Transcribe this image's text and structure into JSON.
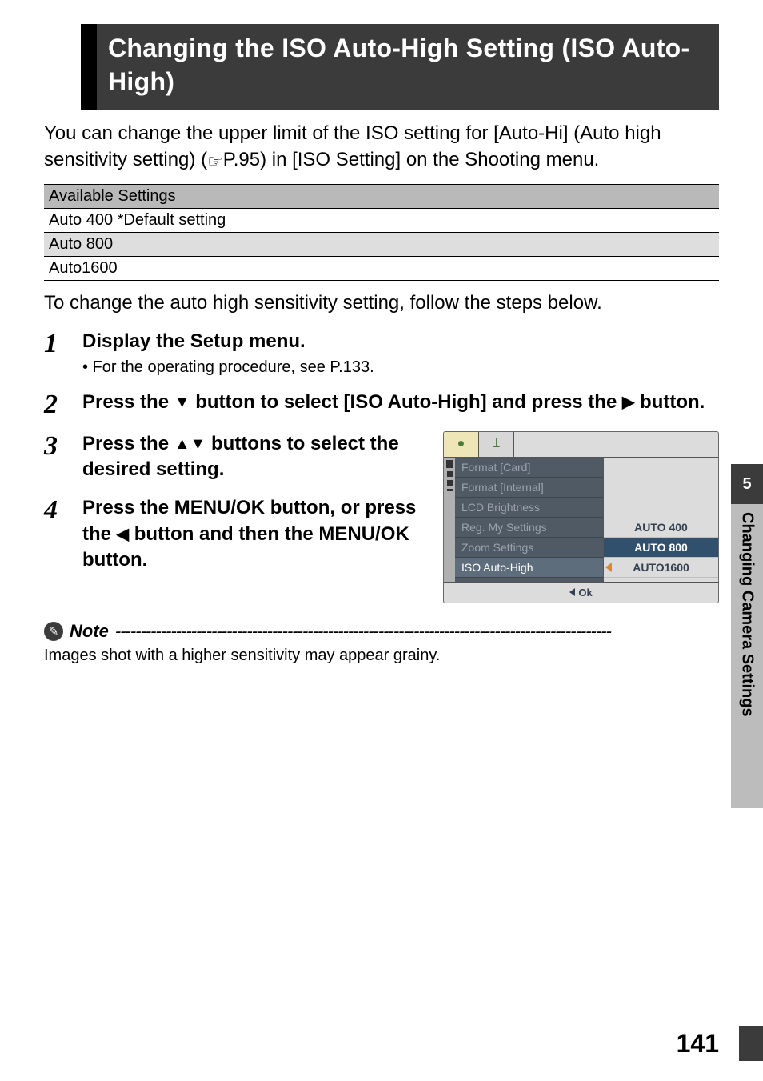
{
  "title": "Changing the ISO Auto-High Setting (ISO Auto-High)",
  "intro_paragraph_pre": "You can change the upper limit of the ISO setting for [Auto-Hi] (Auto high sensitivity setting) (",
  "intro_ref": "P.95",
  "intro_paragraph_post": ") in [ISO Setting] on the Shooting menu.",
  "settings_header": "Available Settings",
  "settings": [
    "Auto 400 *Default setting",
    "Auto 800",
    "Auto1600"
  ],
  "intro_steps": "To change the auto high sensitivity setting, follow the steps below.",
  "steps": {
    "s1": {
      "num": "1",
      "title": "Display the Setup menu.",
      "sub": "• For the operating procedure, see P.133."
    },
    "s2": {
      "num": "2",
      "title_pre": "Press the ",
      "title_mid": " button to select [ISO Auto-High] and press the ",
      "title_post": " button."
    },
    "s3": {
      "num": "3",
      "title_pre": "Press the ",
      "title_post": " buttons to select the desired setting."
    },
    "s4": {
      "num": "4",
      "title_pre": "Press the MENU/OK button, or press the ",
      "title_post": " button and then the MENU/OK button."
    }
  },
  "note_label": "Note",
  "note_text": "Images shot with a higher sensitivity may appear grainy.",
  "lcd": {
    "tab1": "●",
    "tab2": "⟘",
    "menu": [
      "Format [Card]",
      "Format [Internal]",
      "LCD Brightness",
      "Reg. My Settings",
      "Zoom Settings",
      "ISO Auto-High"
    ],
    "options": [
      "AUTO 400",
      "AUTO 800",
      "AUTO1600"
    ],
    "footer": "Ok"
  },
  "side": {
    "chapter_num": "5",
    "chapter_title": "Changing Camera Settings"
  },
  "page_number": "141"
}
